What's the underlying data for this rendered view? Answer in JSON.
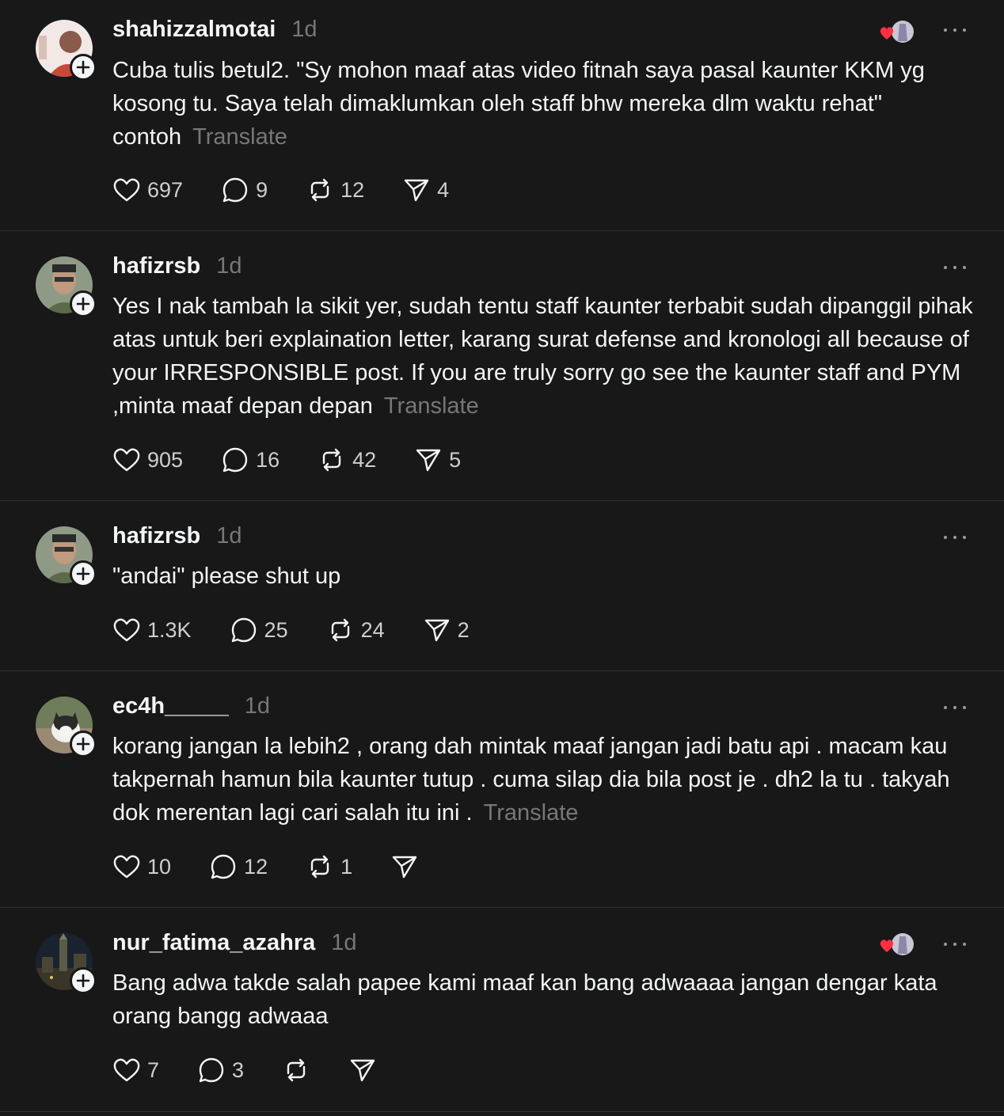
{
  "translate_label": "Translate",
  "posts": [
    {
      "username": "shahizzalmotai",
      "time": "1d",
      "text": "Cuba tulis betul2. \"Sy mohon maaf atas video fitnah saya pasal kaunter KKM yg kosong tu. Saya telah dimaklumkan oleh staff bhw mereka dlm waktu rehat\" contoh",
      "translatable": true,
      "liked_by_author": true,
      "counts": {
        "likes": "697",
        "replies": "9",
        "reposts": "12",
        "shares": "4"
      }
    },
    {
      "username": "hafizrsb",
      "time": "1d",
      "text": "Yes I nak tambah la sikit yer, sudah tentu staff kaunter terbabit sudah dipanggil pihak atas untuk beri explaination letter, karang surat defense and kronologi all because of your IRRESPONSIBLE post. If you are truly sorry go see the kaunter staff and PYM ,minta maaf depan depan",
      "translatable": true,
      "liked_by_author": false,
      "counts": {
        "likes": "905",
        "replies": "16",
        "reposts": "42",
        "shares": "5"
      }
    },
    {
      "username": "hafizrsb",
      "time": "1d",
      "text": "\"andai\" please shut up",
      "translatable": false,
      "liked_by_author": false,
      "counts": {
        "likes": "1.3K",
        "replies": "25",
        "reposts": "24",
        "shares": "2"
      }
    },
    {
      "username": "ec4h_____",
      "time": "1d",
      "text": "korang jangan la lebih2 , orang dah mintak maaf jangan jadi batu api . macam kau takpernah hamun bila kaunter tutup . cuma silap dia bila post je . dh2 la tu . takyah dok merentan lagi cari salah itu ini .",
      "translatable": true,
      "liked_by_author": false,
      "counts": {
        "likes": "10",
        "replies": "12",
        "reposts": "1",
        "shares": ""
      }
    },
    {
      "username": "nur_fatima_azahra",
      "time": "1d",
      "text": "Bang adwa takde salah papee kami maaf kan bang adwaaaa jangan dengar kata orang bangg adwaaa",
      "translatable": false,
      "liked_by_author": true,
      "counts": {
        "likes": "7",
        "replies": "3",
        "reposts": "",
        "shares": ""
      }
    }
  ],
  "icons": [
    "plus-icon",
    "more-icon",
    "heart-icon",
    "comment-icon",
    "repost-icon",
    "send-icon"
  ],
  "colors": {
    "background": "#181818",
    "text": "#f3f5f7",
    "muted": "#777777",
    "divider": "#323232",
    "heart": "#ff3040"
  }
}
